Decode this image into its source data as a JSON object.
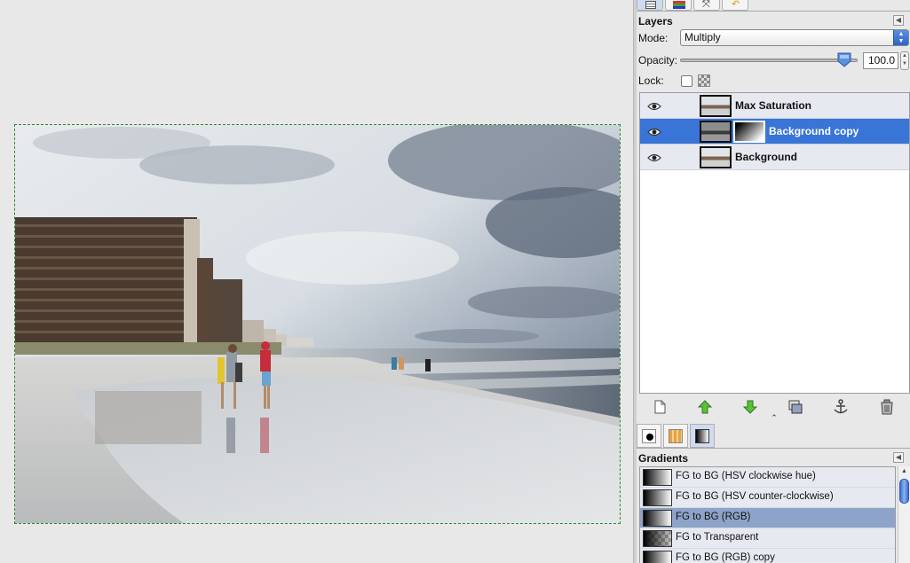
{
  "canvas": {
    "image_description": "beach-photo"
  },
  "dock_tabs": [
    {
      "icon": "layers-tab-icon"
    },
    {
      "icon": "channels-tab-icon"
    },
    {
      "icon": "paths-tab-icon"
    },
    {
      "icon": "undo-tab-icon"
    }
  ],
  "layers_panel": {
    "title": "Layers",
    "mode_label": "Mode:",
    "mode_value": "Multiply",
    "opacity_label": "Opacity:",
    "opacity_value": "100.0",
    "opacity_level": 1.0,
    "lock_label": "Lock:",
    "layers": [
      {
        "name": "Max Saturation",
        "visible": true,
        "selected": false,
        "has_mask": false
      },
      {
        "name": "Background copy",
        "visible": true,
        "selected": true,
        "has_mask": true
      },
      {
        "name": "Background",
        "visible": true,
        "selected": false,
        "has_mask": false
      }
    ],
    "toolbar_icons": [
      "new-layer-icon",
      "raise-layer-icon",
      "lower-layer-icon",
      "duplicate-layer-icon",
      "anchor-layer-icon",
      "delete-layer-icon"
    ]
  },
  "brush_tabs": [
    {
      "icon": "brushes-tab-icon"
    },
    {
      "icon": "patterns-tab-icon"
    },
    {
      "icon": "gradients-tab-icon"
    }
  ],
  "gradients_panel": {
    "title": "Gradients",
    "items": [
      {
        "name": "FG to BG (HSV clockwise hue)",
        "selected": false
      },
      {
        "name": "FG to BG (HSV counter-clockwise)",
        "selected": false
      },
      {
        "name": "FG to BG (RGB)",
        "selected": true
      },
      {
        "name": "FG to Transparent",
        "selected": false
      },
      {
        "name": "FG to BG (RGB) copy",
        "selected": false
      }
    ]
  },
  "colors": {
    "selection": "#3875d7",
    "gradient_selection": "#8da3c9",
    "canvas_bg": "#e8e8e8",
    "marching_ants": "#2b8a2b"
  }
}
